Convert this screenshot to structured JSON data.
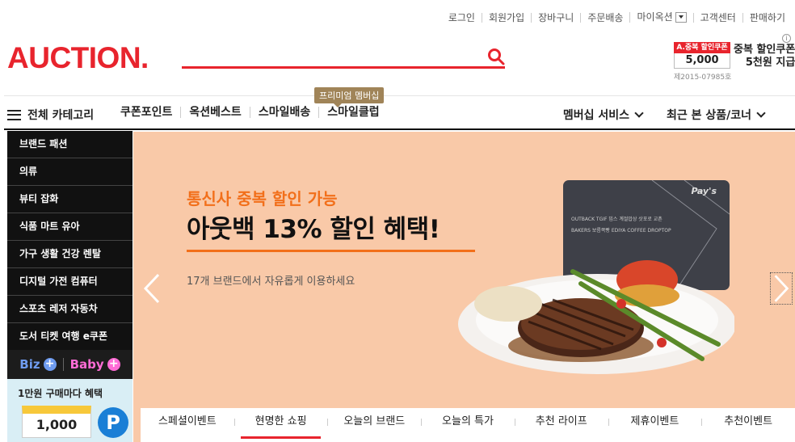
{
  "header": {
    "util_links": [
      "로그인",
      "회원가입",
      "장바구니",
      "주문배송",
      "마이옥션",
      "고객센터",
      "판매하기"
    ],
    "logo": "AUCTION.",
    "search_placeholder": "",
    "coupon": {
      "badge": "A.중복 할인쿠폰",
      "amount": "5,000",
      "reg_no": "제2015-07985호",
      "line1": "중복 할인쿠폰",
      "line2": "5천원 지급",
      "info": "i"
    }
  },
  "nav": {
    "all_categories": "전체 카테고리",
    "menu": [
      "쿠폰포인트",
      "옥션베스트",
      "스마일배송",
      "스마일클럽"
    ],
    "tooltip": "프리미엄 멤버십",
    "right": [
      "멤버십 서비스",
      "최근 본 상품/코너"
    ]
  },
  "sidebar": {
    "categories": [
      "브랜드 패션",
      "의류",
      "뷰티 잡화",
      "식품 마트 유아",
      "가구 생활 건강 렌탈",
      "디지털 가전 컴퓨터",
      "스포츠 레저 자동차",
      "도서 티켓 여행 e쿠폰"
    ],
    "biz": "Biz",
    "baby": "Baby",
    "promo_title": "1만원 구매마다 혜택",
    "promo_amount": "1,000",
    "promo_symbol": "P"
  },
  "banner": {
    "subtitle": "통신사 중복 할인 가능",
    "title": "아웃백 13% 할인 혜택!",
    "description": "17개 브랜드에서 자유롭게 이용하세요",
    "card_logo": "Pay's",
    "card_brands": "OUTBACK  TGIF  빕스  계절밥상  삿포로  교촌  BAKERS  보름쪽빵  EDIYA COFFEE  DROPTOP",
    "tabs": [
      "스페셜이벤트",
      "현명한 쇼핑",
      "오늘의 브랜드",
      "오늘의 특가",
      "추천 라이프",
      "제휴이벤트",
      "추천이벤트"
    ],
    "active_tab": 1
  },
  "colors": {
    "brand_red": "#e8242d",
    "banner_bg": "#f9c9a8",
    "accent_orange": "#f26f1a"
  }
}
